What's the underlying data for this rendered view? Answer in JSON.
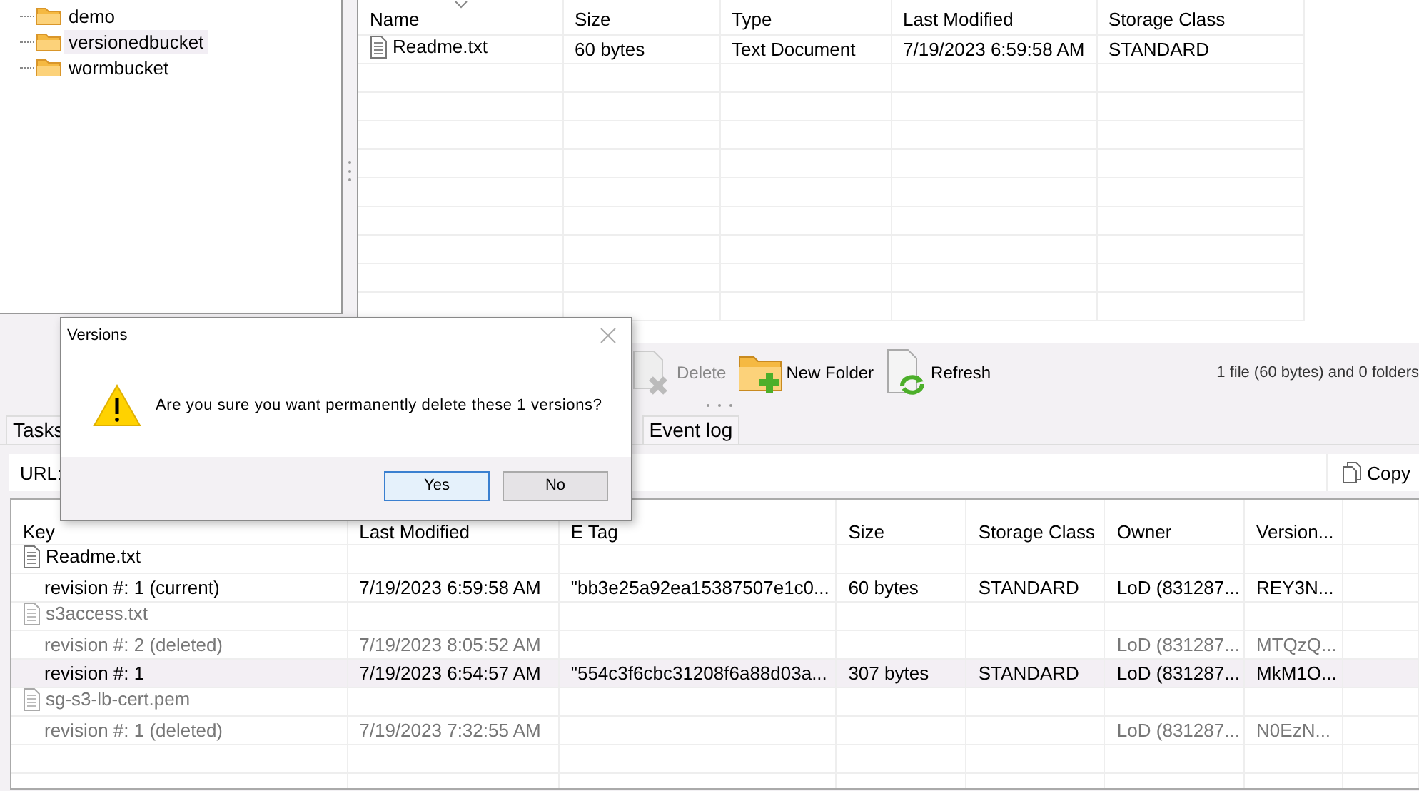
{
  "tree": {
    "items": [
      {
        "label": "demo",
        "selected": false
      },
      {
        "label": "versionedbucket",
        "selected": true
      },
      {
        "label": "wormbucket",
        "selected": false
      }
    ]
  },
  "file_list": {
    "columns": [
      "Name",
      "Size",
      "Type",
      "Last Modified",
      "Storage Class"
    ],
    "rows": [
      {
        "cells": [
          "Readme.txt",
          "60 bytes",
          "Text Document",
          "7/19/2023 6:59:58 AM",
          "STANDARD"
        ]
      }
    ]
  },
  "toolbar": {
    "buttons": [
      {
        "kind": "delete",
        "label": "Delete",
        "disabled": true
      },
      {
        "kind": "new-folder",
        "label": "New Folder",
        "disabled": false
      },
      {
        "kind": "refresh",
        "label": "Refresh",
        "disabled": false
      }
    ],
    "summary": "1 file (60 bytes) and 0 folders"
  },
  "tabs": [
    {
      "label": "Tasks"
    },
    {
      "label": "Event log"
    }
  ],
  "url_bar": {
    "label": "URL:",
    "copy_button": "Copy"
  },
  "versions": {
    "columns": [
      "Key",
      "Last Modified",
      "E Tag",
      "Size",
      "Storage Class",
      "Owner",
      "Version..."
    ],
    "rows": [
      {
        "kind": "file",
        "deleted": false,
        "selected": false,
        "cells": [
          "Readme.txt"
        ]
      },
      {
        "kind": "revision",
        "deleted": false,
        "selected": false,
        "cells": [
          "revision #: 1 (current)",
          "7/19/2023 6:59:58 AM",
          "\"bb3e25a92ea15387507e1c0...",
          "60 bytes",
          "STANDARD",
          "LoD (831287...",
          "REY3N..."
        ]
      },
      {
        "kind": "file",
        "deleted": true,
        "selected": false,
        "cells": [
          "s3access.txt"
        ]
      },
      {
        "kind": "revision",
        "deleted": true,
        "selected": false,
        "cells": [
          "revision #: 2 (deleted)",
          "7/19/2023 8:05:52 AM",
          "",
          "",
          "",
          "LoD (831287...",
          "MTQzQ..."
        ]
      },
      {
        "kind": "revision",
        "deleted": false,
        "selected": true,
        "cells": [
          "revision #: 1",
          "7/19/2023 6:54:57 AM",
          "\"554c3f6cbc31208f6a88d03a...",
          "307 bytes",
          "STANDARD",
          "LoD (831287...",
          "MkM1O..."
        ]
      },
      {
        "kind": "file",
        "deleted": true,
        "selected": false,
        "cells": [
          "sg-s3-lb-cert.pem"
        ]
      },
      {
        "kind": "revision",
        "deleted": true,
        "selected": false,
        "cells": [
          "revision #: 1 (deleted)",
          "7/19/2023 7:32:55 AM",
          "",
          "",
          "",
          "LoD (831287...",
          "N0EzN..."
        ]
      }
    ]
  },
  "dialog": {
    "title": "Versions",
    "message": "Are you sure you want permanently delete these 1 versions?",
    "buttons": [
      {
        "label": "Yes",
        "selected": true
      },
      {
        "label": "No",
        "selected": false
      }
    ]
  }
}
